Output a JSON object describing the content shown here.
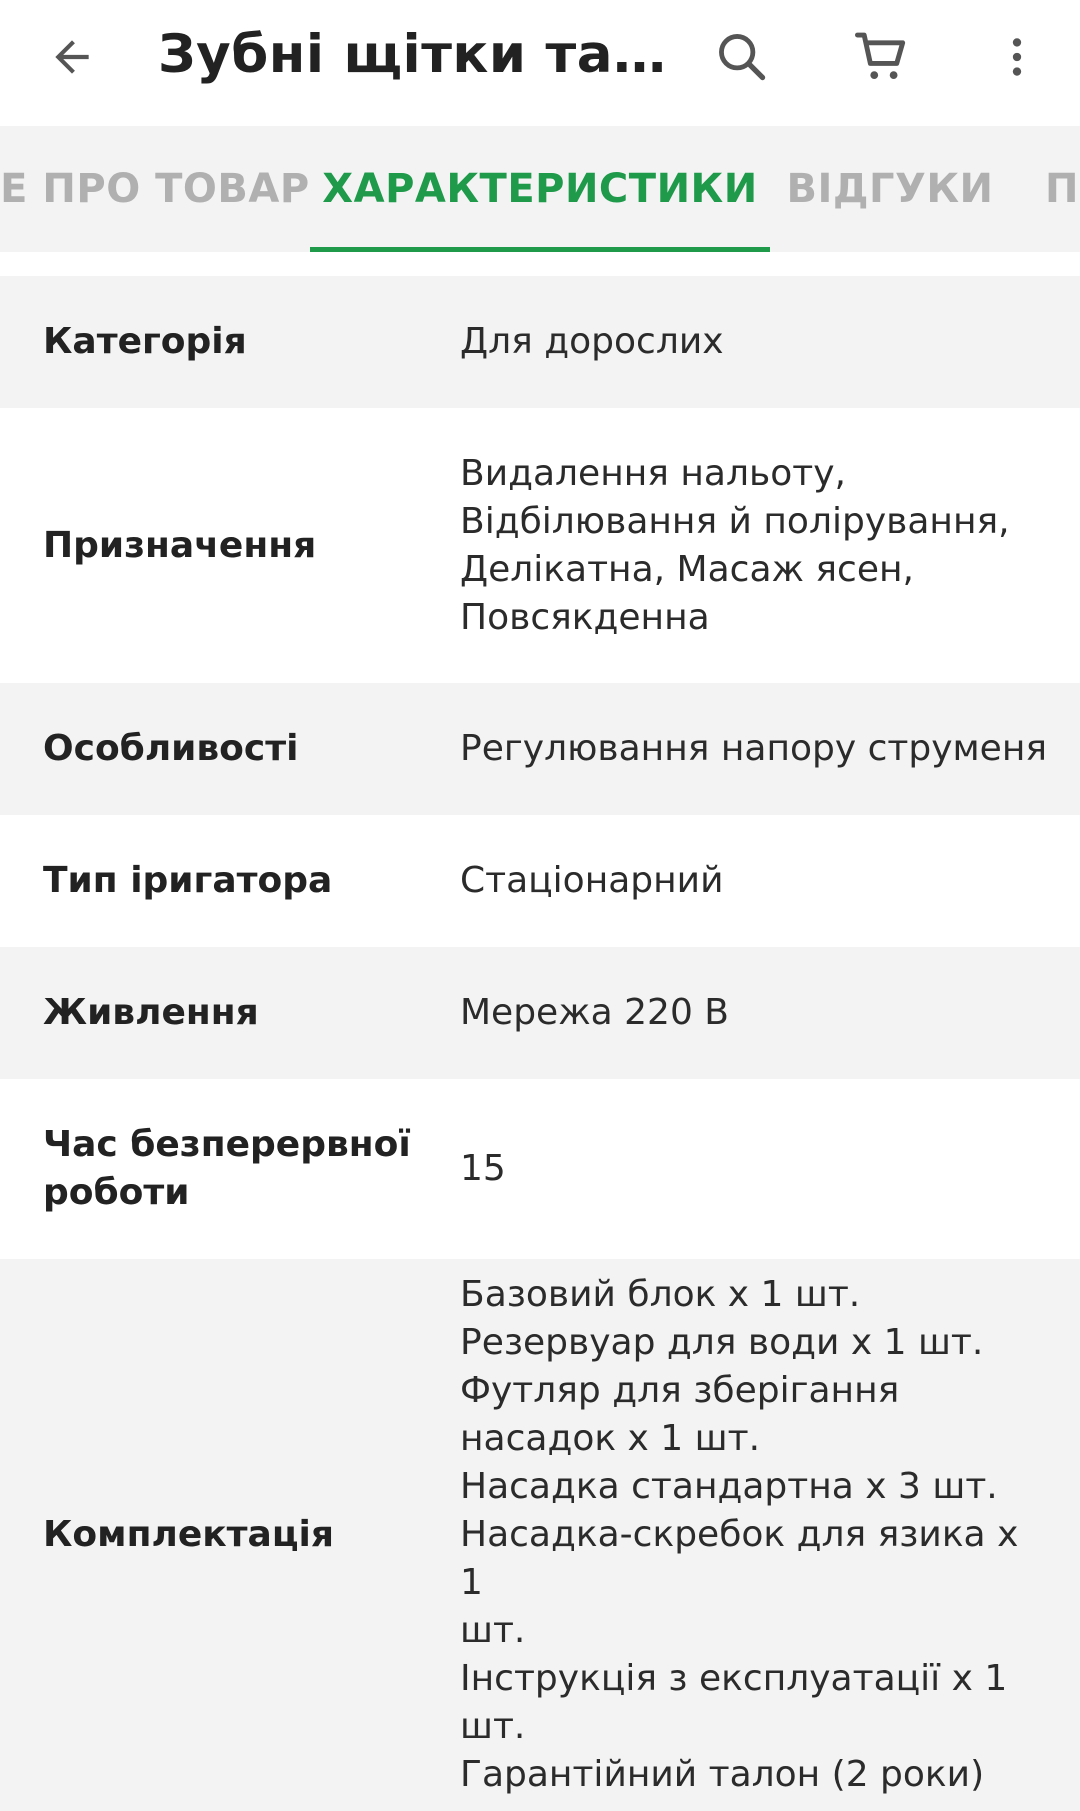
{
  "header": {
    "title": "Зубні щітки та і...",
    "back_icon": "arrow-left-icon",
    "search_icon": "search-icon",
    "cart_icon": "cart-icon",
    "more_icon": "more-vertical-icon"
  },
  "tabs": [
    {
      "label": "СЕ ПРО ТОВАР"
    },
    {
      "label": "ХАРАКТЕРИСТИКИ"
    },
    {
      "label": "ВІДГУКИ"
    },
    {
      "label": "П"
    }
  ],
  "colors": {
    "accent": "#1e9a4a",
    "inactive_tab": "#b0b0b0",
    "shaded_row": "#f3f3f3"
  },
  "specs": [
    {
      "label": "Категорія",
      "value": "Для дорослих"
    },
    {
      "label": "Призначення",
      "value": "Видалення нальоту,\nВідбілювання й полірування,\nДелікатна, Масаж ясен,\nПовсякденна"
    },
    {
      "label": "Особливості",
      "value": "Регулювання напору струменя"
    },
    {
      "label": "Тип іригатора",
      "value": "Стаціонарний"
    },
    {
      "label": "Живлення",
      "value": "Мережа 220 В"
    },
    {
      "label": "Час безперервної роботи",
      "value": "15"
    },
    {
      "label": "Комплектація",
      "value": "Базовий блок х 1 шт.\nРезервуар для води х 1 шт.\nФутляр для зберігання\nнасадок х 1 шт.\nНасадка стандартна х 3 шт.\nНасадка-скребок для язика х 1\nшт.\nІнструкція з експлуатації х 1 шт.\nГарантійний талон (2 роки)"
    }
  ]
}
